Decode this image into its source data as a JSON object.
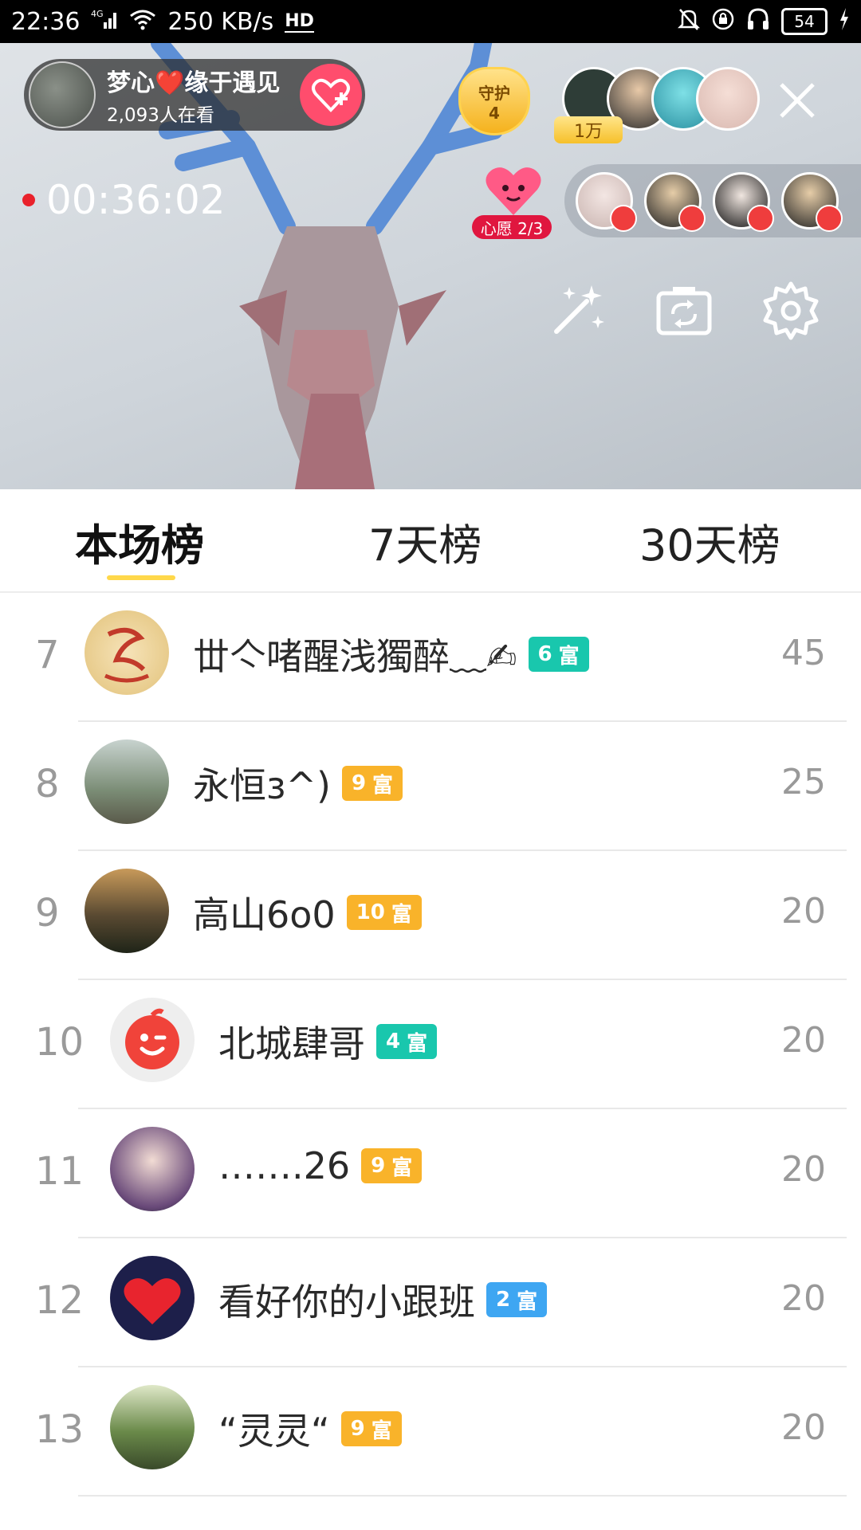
{
  "status_bar": {
    "time": "22:36",
    "network": "4G",
    "speed": "250 KB/s",
    "hd": "HD",
    "battery": "54"
  },
  "live": {
    "host_name": "梦心❤️缘于遇见",
    "viewers": "2,093人在看",
    "guard_label": "守护",
    "guard_count": "4",
    "top_viewer_badge": "1万",
    "timer": "00:36:02",
    "wish_label": "心愿 2/3"
  },
  "tabs": [
    {
      "label": "本场榜",
      "active": true
    },
    {
      "label": "7天榜",
      "active": false
    },
    {
      "label": "30天榜",
      "active": false
    }
  ],
  "ranking": [
    {
      "rank": "7",
      "name": "丗亽啫醒浅獨醉﹏✍",
      "level": "6",
      "badge_text": "富",
      "badge_color": "#19c7ad",
      "score": "45"
    },
    {
      "rank": "8",
      "name": "永恒з^)",
      "level": "9",
      "badge_text": "富",
      "badge_color": "#f9b32a",
      "score": "25"
    },
    {
      "rank": "9",
      "name": "高山6o0",
      "level": "10",
      "badge_text": "富",
      "badge_color": "#f9b32a",
      "score": "20"
    },
    {
      "rank": "10",
      "name": "北城肆哥",
      "level": "4",
      "badge_text": "富",
      "badge_color": "#19c7ad",
      "score": "20"
    },
    {
      "rank": "11",
      "name": "…….26",
      "level": "9",
      "badge_text": "富",
      "badge_color": "#f9b32a",
      "score": "20"
    },
    {
      "rank": "12",
      "name": "看好你的小跟班",
      "level": "2",
      "badge_text": "富",
      "badge_color": "#3ea6f2",
      "score": "20"
    },
    {
      "rank": "13",
      "name": "“灵灵“",
      "level": "9",
      "badge_text": "富",
      "badge_color": "#f9b32a",
      "score": "20"
    }
  ]
}
